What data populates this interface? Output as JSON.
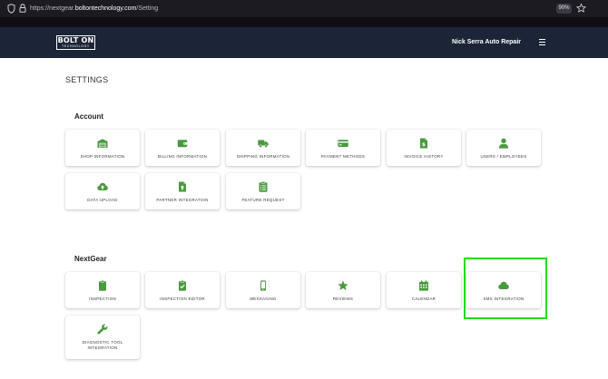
{
  "browser": {
    "url_prefix": "https://nextgear.",
    "url_domain": "boltontechnology.com",
    "url_path": "/Setting",
    "zoom": "90%"
  },
  "header": {
    "logo_top": "BOLT ON",
    "logo_bottom": "TECHNOLOGY",
    "shop_name": "Nick Serra Auto Repair"
  },
  "page": {
    "title": "SETTINGS"
  },
  "accent_color": "#4a9a3f",
  "highlight_color": "#22dd11",
  "account": {
    "title": "Account",
    "cards": [
      {
        "label": "SHOP INFORMATION",
        "icon": "warehouse-icon"
      },
      {
        "label": "BILLING INFORMATION",
        "icon": "wallet-icon"
      },
      {
        "label": "SHIPPING INFORMATION",
        "icon": "truck-icon"
      },
      {
        "label": "PAYMENT METHODS",
        "icon": "credit-card-icon"
      },
      {
        "label": "INVOICE HISTORY",
        "icon": "invoice-icon"
      },
      {
        "label": "USERS / EMPLOYEES",
        "icon": "user-icon"
      },
      {
        "label": "DATA UPLOAD",
        "icon": "cloud-upload-icon"
      },
      {
        "label": "PARTNER INTEGRATION",
        "icon": "file-upload-icon"
      },
      {
        "label": "FEATURE REQUEST",
        "icon": "clipboard-list-icon"
      }
    ]
  },
  "nextgear": {
    "title": "NextGear",
    "cards": [
      {
        "label": "INSPECTION",
        "icon": "clipboard-icon"
      },
      {
        "label": "INSPECTION EDITOR",
        "icon": "clipboard-check-icon"
      },
      {
        "label": "MESSAGING",
        "icon": "mobile-phone-icon"
      },
      {
        "label": "REVIEWS",
        "icon": "star-icon"
      },
      {
        "label": "CALENDAR",
        "icon": "calendar-icon"
      },
      {
        "label": "SMS INTEGRATION",
        "icon": "cloud-icon"
      },
      {
        "label": "DIAGNOSTIC TOOL INTEGRATION",
        "icon": "wrench-icon"
      }
    ]
  }
}
